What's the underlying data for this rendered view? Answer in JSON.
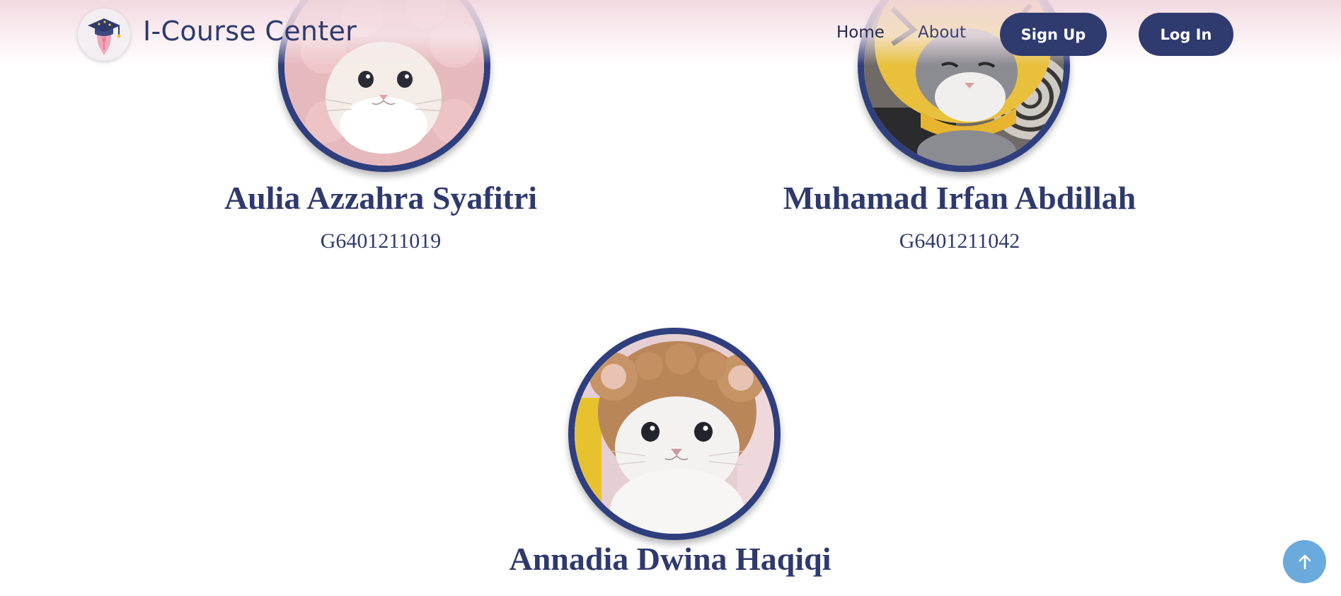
{
  "header": {
    "brand_title": "I-Course Center",
    "logo_icon": "graduation-pen-logo-icon",
    "nav": {
      "home": "Home",
      "about": "About"
    },
    "buttons": {
      "signup": "Sign Up",
      "login": "Log In"
    }
  },
  "members": [
    {
      "name": "Aulia Azzahra Syafitri",
      "id": "G6401211019",
      "photo": "cat-pink-hood-photo"
    },
    {
      "name": "Muhamad Irfan Abdillah",
      "id": "G6401211042",
      "photo": "cat-tiger-hood-photo"
    },
    {
      "name": "Annadia Dwina Haqiqi",
      "id": "",
      "photo": "cat-bear-hood-photo"
    }
  ],
  "scroll_top": {
    "icon": "arrow-up-icon"
  },
  "colors": {
    "primary": "#2f3a6f",
    "avatar_ring": "#2f3f7d",
    "text": "#2e3a6e",
    "scroll_button": "#6aaadd",
    "header_tint": "#f1d6de"
  }
}
